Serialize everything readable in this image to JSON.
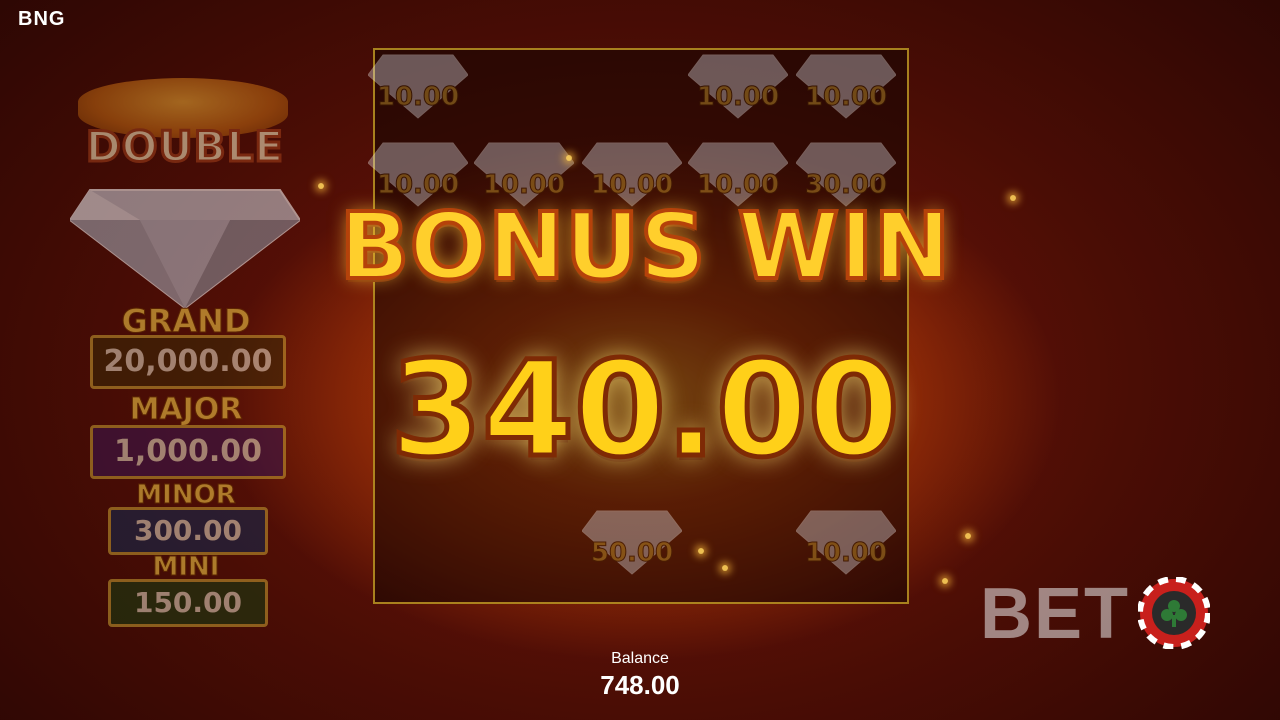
{
  "provider": "BNG",
  "jackpot": {
    "title": "DOUBLE",
    "tiers": [
      {
        "name": "GRAND",
        "value": "20,000.00",
        "color": "#6b5a12"
      },
      {
        "name": "MAJOR",
        "value": "1,000.00",
        "color": "#5a2a7a"
      },
      {
        "name": "MINOR",
        "value": "300.00",
        "color": "#1e4a8a"
      },
      {
        "name": "MINI",
        "value": "150.00",
        "color": "#2a6a1e"
      }
    ]
  },
  "grid_values": {
    "r0c0": "10.00",
    "r0c3": "10.00",
    "r0c4": "10.00",
    "r1c0": "10.00",
    "r1c1": "10.00",
    "r1c2": "10.00",
    "r1c3": "10.00",
    "r1c4": "30.00",
    "r5c2": "50.00",
    "r5c4": "10.00"
  },
  "bonus": {
    "title": "BONUS WIN",
    "amount": "340.00"
  },
  "balance": {
    "label": "Balance",
    "value": "748.00"
  },
  "watermark": {
    "text": "BET"
  },
  "colors": {
    "accent_gold": "#ffcf2c",
    "outline_orange": "#b5420a",
    "background_red": "#4a0d05"
  }
}
